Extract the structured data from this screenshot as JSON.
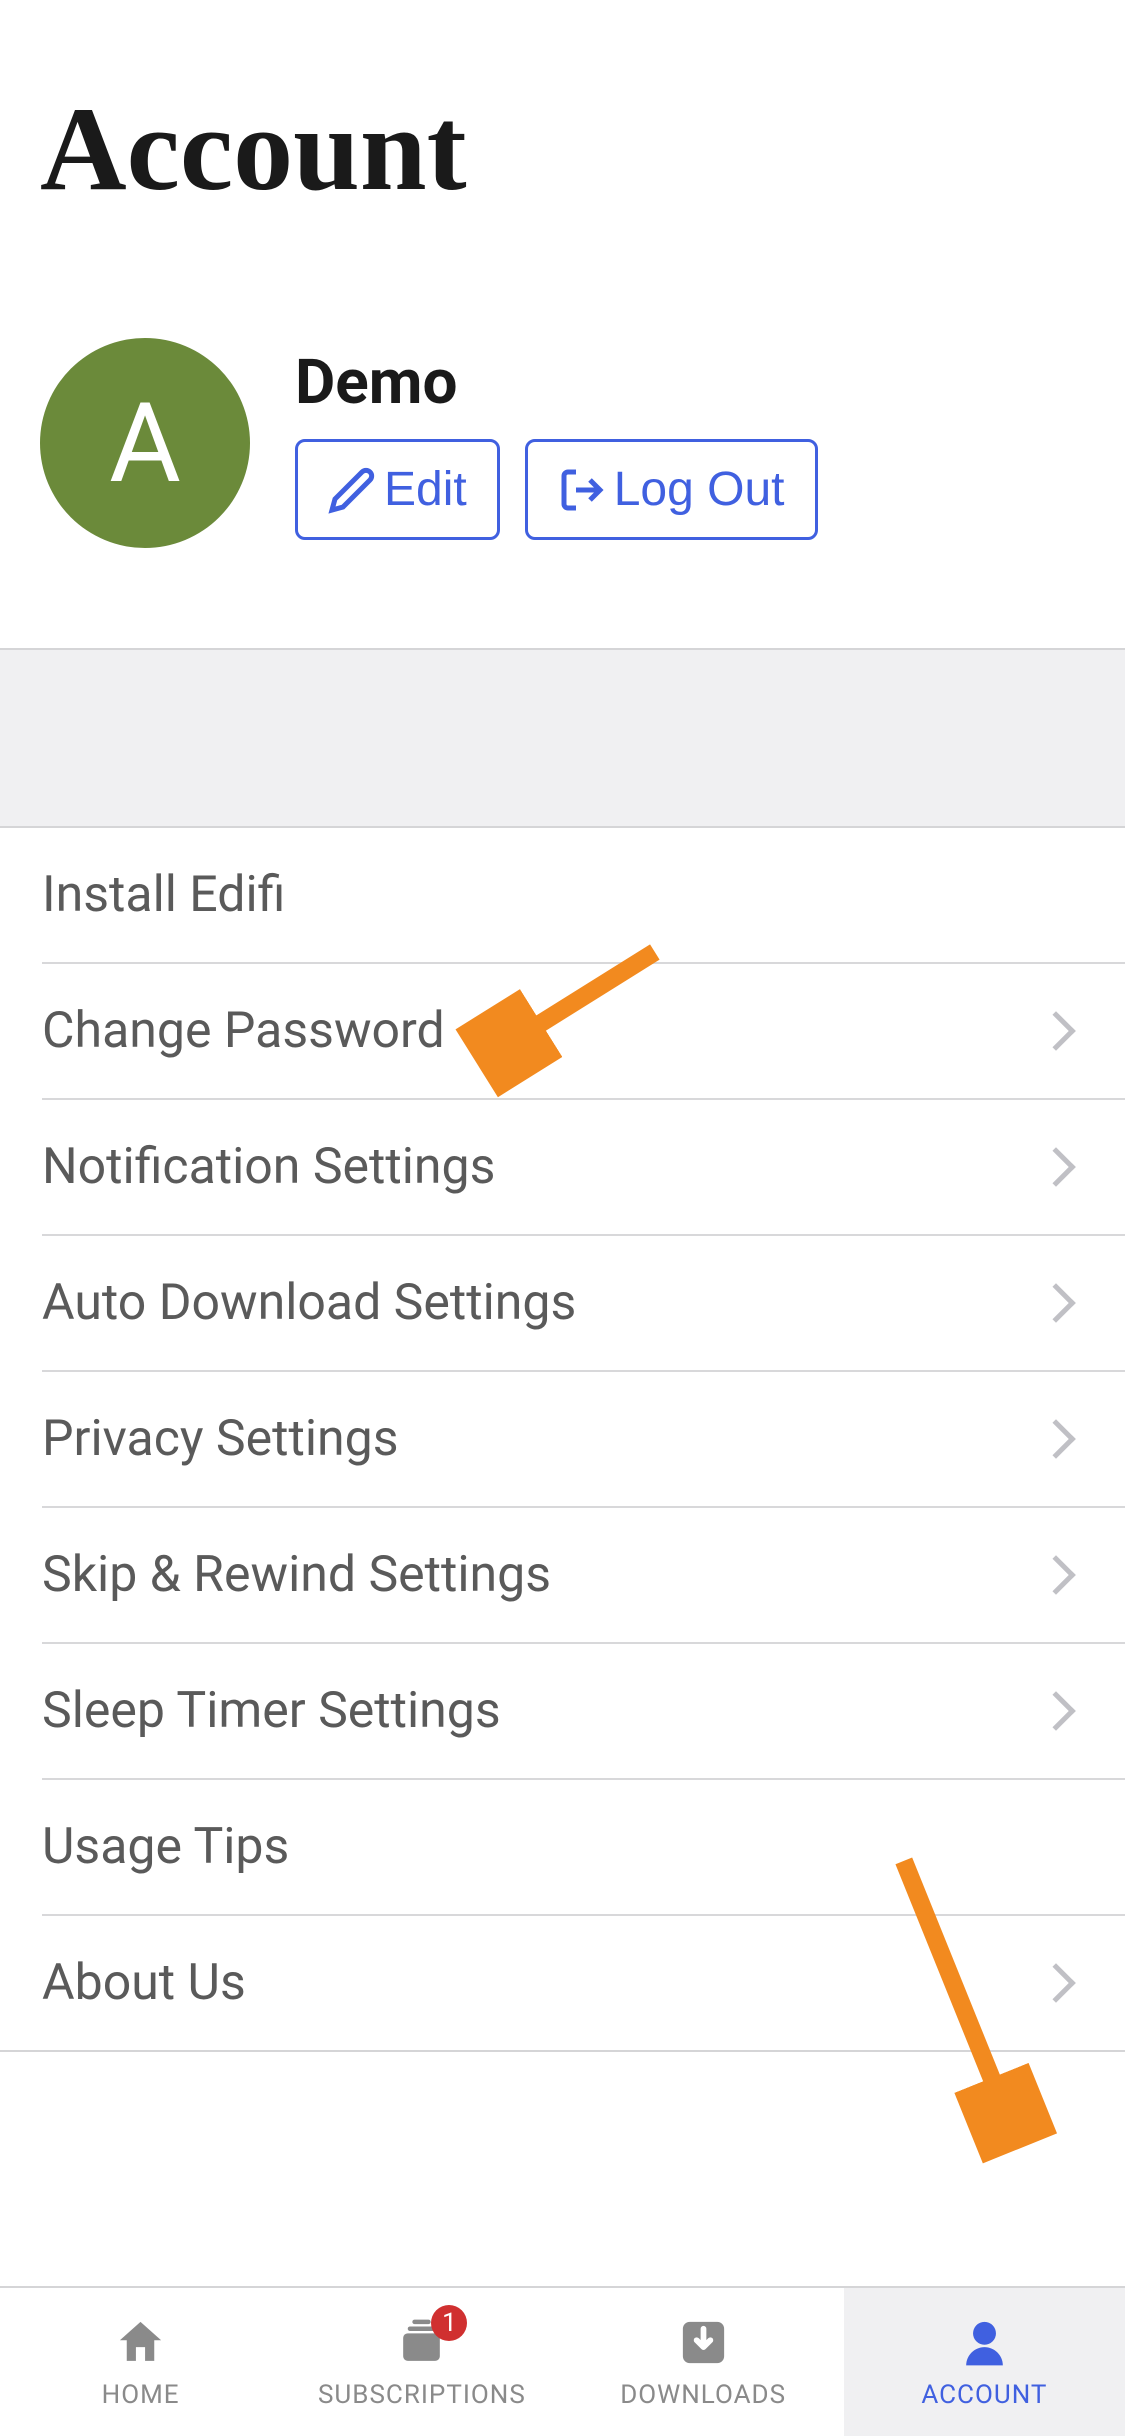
{
  "page": {
    "title": "Account"
  },
  "profile": {
    "avatar_letter": "A",
    "username": "Demo",
    "edit_label": "Edit",
    "logout_label": "Log Out"
  },
  "settings": [
    {
      "label": "Install Edifi",
      "chevron": false
    },
    {
      "label": "Change Password",
      "chevron": true
    },
    {
      "label": "Notification Settings",
      "chevron": true
    },
    {
      "label": "Auto Download Settings",
      "chevron": true
    },
    {
      "label": "Privacy Settings",
      "chevron": true
    },
    {
      "label": "Skip & Rewind Settings",
      "chevron": true
    },
    {
      "label": "Sleep Timer Settings",
      "chevron": true
    },
    {
      "label": "Usage Tips",
      "chevron": false
    },
    {
      "label": "About Us",
      "chevron": true
    }
  ],
  "tabbar": {
    "home": "HOME",
    "subscriptions": "SUBSCRIPTIONS",
    "subscriptions_badge": "1",
    "downloads": "DOWNLOADS",
    "account": "ACCOUNT"
  },
  "colors": {
    "accent": "#4060e0",
    "avatar_bg": "#6b8a3a",
    "annotation": "#f28a1f"
  }
}
